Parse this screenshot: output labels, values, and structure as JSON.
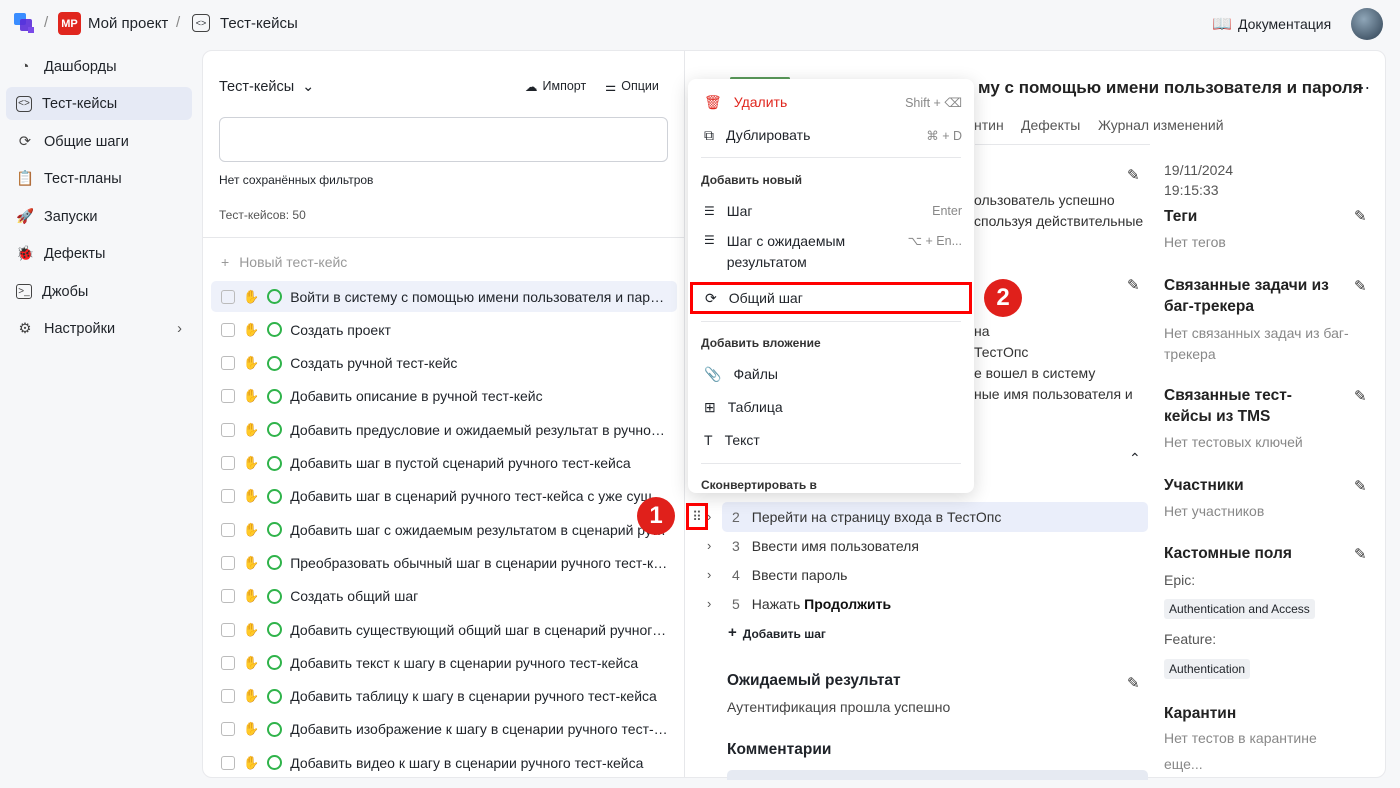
{
  "breadcrumb": {
    "project_badge": "MP",
    "project": "Мой проект",
    "section": "Тест-кейсы"
  },
  "header": {
    "docs": "Документация"
  },
  "sidebar": {
    "items": [
      {
        "label": "Дашборды",
        "icon": "pie-chart-icon"
      },
      {
        "label": "Тест-кейсы",
        "icon": "code-icon",
        "active": true
      },
      {
        "label": "Общие шаги",
        "icon": "shared-step-icon"
      },
      {
        "label": "Тест-планы",
        "icon": "clipboard-icon"
      },
      {
        "label": "Запуски",
        "icon": "rocket-icon"
      },
      {
        "label": "Дефекты",
        "icon": "bug-icon"
      },
      {
        "label": "Джобы",
        "icon": "terminal-icon"
      },
      {
        "label": "Настройки",
        "icon": "gear-icon"
      }
    ]
  },
  "list": {
    "title": "Тест-кейсы",
    "import": "Импорт",
    "options": "Опции",
    "filter_placeholder": "",
    "no_filters": "Нет сохранённых фильтров",
    "count": "Тест-кейсов: 50",
    "new": "Новый тест-кейс",
    "items": [
      "Войти в систему с помощью имени пользователя и пароля",
      "Создать проект",
      "Создать ручной тест-кейс",
      "Добавить описание в ручной тест-кейс",
      "Добавить предусловие и ожидаемый результат в ручной тест-кейс",
      "Добавить шаг в пустой сценарий ручного тест-кейса",
      "Добавить шаг в сценарий ручного тест-кейса с уже существующими шагами",
      "Добавить шаг с ожидаемым результатом в сценарий ручного тест-кейса",
      "Преобразовать обычный шаг в сценарии ручного тест-кейса",
      "Создать общий шаг",
      "Добавить существующий общий шаг в сценарий ручного тест-кейса",
      "Добавить текст к шагу в сценарии ручного тест-кейса",
      "Добавить таблицу к шагу в сценарии ручного тест-кейса",
      "Добавить изображение к шагу в сценарии ручного тест-кейса",
      "Добавить видео к шагу в сценарии ручного тест-кейса"
    ]
  },
  "detail": {
    "title_fragment": "му с помощью имени пользователя и пароля",
    "tabs": [
      "нтин",
      "Дефекты",
      "Журнал изменений"
    ],
    "desc_fragments": [
      "ользователь успешно",
      "спользуя действительные"
    ],
    "pre_fragments": [
      "на",
      "ТестОпс",
      "е вошел в систему",
      "ные имя пользователя и"
    ],
    "steps": [
      {
        "n": "2",
        "text": "Перейти на страницу входа в ТестОпс"
      },
      {
        "n": "3",
        "text": "Ввести имя пользователя"
      },
      {
        "n": "4",
        "text": "Ввести пароль"
      },
      {
        "n": "5",
        "text": "Нажать ",
        "bold": "Продолжить"
      }
    ],
    "add_step": "Добавить шаг",
    "expected_title": "Ожидаемый результат",
    "expected": "Аутентификация прошла успешно",
    "comments": "Комментарии"
  },
  "meta": {
    "date": "19/11/2024",
    "time": "19:15:33",
    "tags": "Теги",
    "tags_empty": "Нет тегов",
    "issues": "Связанные задачи из баг-трекера",
    "issues_empty": "Нет связанных задач из баг-трекера",
    "linked": "Связанные тест-кейсы из TMS",
    "linked_empty": "Нет тестовых ключей",
    "members": "Участники",
    "members_empty": "Нет участников",
    "custom": "Кастомные поля",
    "epic": "Epic:",
    "epic_val": "Authentication and Access",
    "feature": "Feature:",
    "feature_val": "Authentication",
    "quarantine": "Карантин",
    "quarantine_empty": "Нет тестов в карантине",
    "more": "еще..."
  },
  "menu": {
    "delete": "Удалить",
    "delete_sc": "Shift + ⌫",
    "duplicate": "Дублировать",
    "duplicate_sc": "⌘ + D",
    "add_new": "Добавить новый",
    "step": "Шаг",
    "step_sc": "Enter",
    "step_exp": "Шаг с ожидаемым результатом",
    "step_exp_sc": "⌥ + En...",
    "shared": "Общий шаг",
    "attach": "Добавить вложение",
    "files": "Файлы",
    "table": "Таблица",
    "text": "Текст",
    "convert": "Сконвертировать в"
  },
  "annotations": [
    "1",
    "2"
  ],
  "colors": {
    "accent": "#e6eaf5",
    "danger": "#e0261e",
    "status": "#2fb34a",
    "highlight": "#ff0000"
  }
}
